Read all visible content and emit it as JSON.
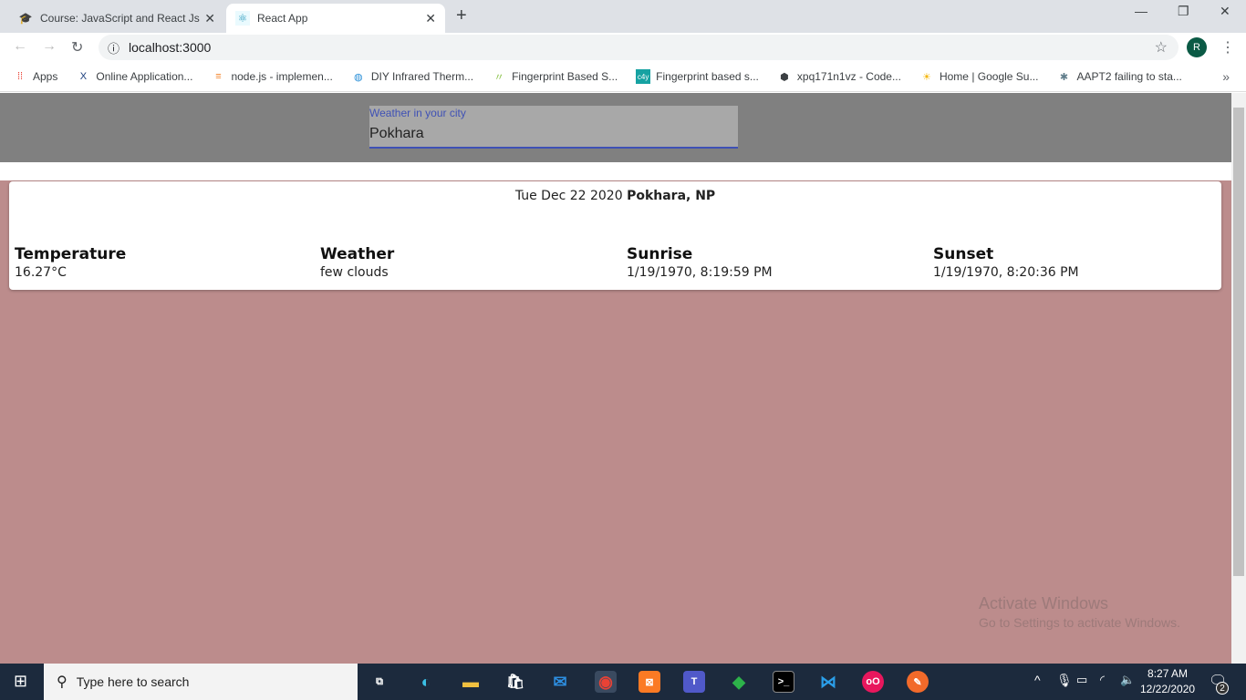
{
  "browser": {
    "tabs": [
      {
        "title": "Course: JavaScript and React Js",
        "icon": "graduation-cap-icon",
        "active": false
      },
      {
        "title": "React App",
        "icon": "react-icon",
        "active": true
      }
    ],
    "url": "localhost:3000",
    "profile_initial": "R",
    "bookmarks": [
      {
        "label": "Apps",
        "icon": "apps-grid-icon"
      },
      {
        "label": "Online Application...",
        "icon": "x-logo-icon"
      },
      {
        "label": "node.js - implemen...",
        "icon": "stackoverflow-icon"
      },
      {
        "label": "DIY Infrared Therm...",
        "icon": "globe-icon"
      },
      {
        "label": "Fingerprint Based S...",
        "icon": "leaf-icon"
      },
      {
        "label": "Fingerprint based s...",
        "icon": "c4y-icon"
      },
      {
        "label": "xpq171n1vz - Code...",
        "icon": "codesandbox-icon"
      },
      {
        "label": "Home | Google Su...",
        "icon": "sun-icon"
      },
      {
        "label": "AAPT2 failing to sta...",
        "icon": "bug-icon"
      }
    ]
  },
  "app": {
    "search": {
      "label": "Weather in your city",
      "value": "Pokhara"
    },
    "date": "Tue Dec 22 2020",
    "location": "Pokhara, NP",
    "stats": [
      {
        "title": "Temperature",
        "value": "16.27°C"
      },
      {
        "title": "Weather",
        "value": "few clouds"
      },
      {
        "title": "Sunrise",
        "value": "1/19/1970, 8:19:59 PM"
      },
      {
        "title": "Sunset",
        "value": "1/19/1970, 8:20:36 PM"
      }
    ],
    "background": "#bc8c8c"
  },
  "watermark": {
    "title": "Activate Windows",
    "subtitle": "Go to Settings to activate Windows."
  },
  "taskbar": {
    "search_placeholder": "Type here to search",
    "time": "8:27 AM",
    "date": "12/22/2020",
    "notifications": "2"
  }
}
